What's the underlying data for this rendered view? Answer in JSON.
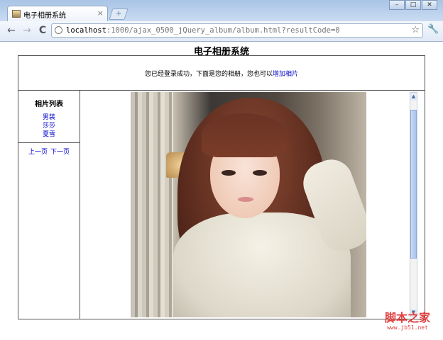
{
  "browser": {
    "tab_title": "电子相册系统",
    "tab_close": "×",
    "new_tab": "+",
    "window_buttons": [
      "–",
      "□",
      "✕"
    ],
    "nav": {
      "back": "←",
      "forward": "→",
      "reload": "C"
    },
    "url_host": "localhost",
    "url_rest": ":1000/ajax_0500_jQuery_album/album.html?resultCode=0",
    "star": "☆",
    "wrench": "🔧"
  },
  "page": {
    "title": "电子相册系统",
    "welcome_text": "您已经登录成功，下面是您的相册，您也可以",
    "add_photo_link": "增加相片",
    "sidebar": {
      "title": "相片列表",
      "photos": [
        "男装",
        "莎莎",
        "夏雪"
      ],
      "prev": "上一页",
      "next": "下一页"
    }
  },
  "scrollbar": {
    "up": "▲",
    "down": "▼"
  },
  "watermark": {
    "main": "脚本之家",
    "sub": "www.jb51.net"
  }
}
